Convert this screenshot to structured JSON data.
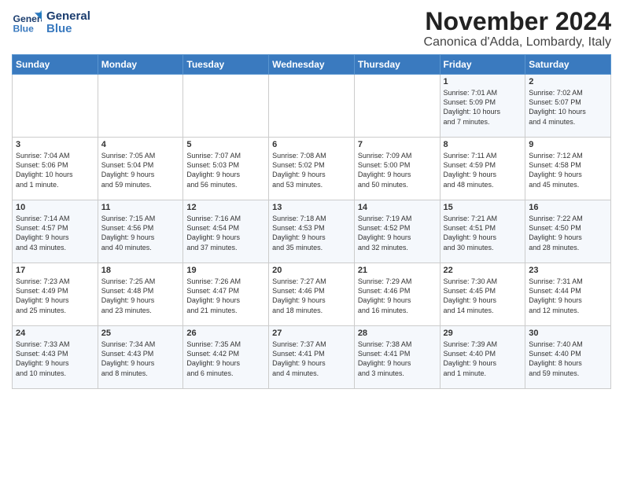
{
  "logo": {
    "line1": "General",
    "line2": "Blue"
  },
  "title": "November 2024",
  "subtitle": "Canonica d'Adda, Lombardy, Italy",
  "headers": [
    "Sunday",
    "Monday",
    "Tuesday",
    "Wednesday",
    "Thursday",
    "Friday",
    "Saturday"
  ],
  "weeks": [
    [
      {
        "num": "",
        "info": ""
      },
      {
        "num": "",
        "info": ""
      },
      {
        "num": "",
        "info": ""
      },
      {
        "num": "",
        "info": ""
      },
      {
        "num": "",
        "info": ""
      },
      {
        "num": "1",
        "info": "Sunrise: 7:01 AM\nSunset: 5:09 PM\nDaylight: 10 hours\nand 7 minutes."
      },
      {
        "num": "2",
        "info": "Sunrise: 7:02 AM\nSunset: 5:07 PM\nDaylight: 10 hours\nand 4 minutes."
      }
    ],
    [
      {
        "num": "3",
        "info": "Sunrise: 7:04 AM\nSunset: 5:06 PM\nDaylight: 10 hours\nand 1 minute."
      },
      {
        "num": "4",
        "info": "Sunrise: 7:05 AM\nSunset: 5:04 PM\nDaylight: 9 hours\nand 59 minutes."
      },
      {
        "num": "5",
        "info": "Sunrise: 7:07 AM\nSunset: 5:03 PM\nDaylight: 9 hours\nand 56 minutes."
      },
      {
        "num": "6",
        "info": "Sunrise: 7:08 AM\nSunset: 5:02 PM\nDaylight: 9 hours\nand 53 minutes."
      },
      {
        "num": "7",
        "info": "Sunrise: 7:09 AM\nSunset: 5:00 PM\nDaylight: 9 hours\nand 50 minutes."
      },
      {
        "num": "8",
        "info": "Sunrise: 7:11 AM\nSunset: 4:59 PM\nDaylight: 9 hours\nand 48 minutes."
      },
      {
        "num": "9",
        "info": "Sunrise: 7:12 AM\nSunset: 4:58 PM\nDaylight: 9 hours\nand 45 minutes."
      }
    ],
    [
      {
        "num": "10",
        "info": "Sunrise: 7:14 AM\nSunset: 4:57 PM\nDaylight: 9 hours\nand 43 minutes."
      },
      {
        "num": "11",
        "info": "Sunrise: 7:15 AM\nSunset: 4:56 PM\nDaylight: 9 hours\nand 40 minutes."
      },
      {
        "num": "12",
        "info": "Sunrise: 7:16 AM\nSunset: 4:54 PM\nDaylight: 9 hours\nand 37 minutes."
      },
      {
        "num": "13",
        "info": "Sunrise: 7:18 AM\nSunset: 4:53 PM\nDaylight: 9 hours\nand 35 minutes."
      },
      {
        "num": "14",
        "info": "Sunrise: 7:19 AM\nSunset: 4:52 PM\nDaylight: 9 hours\nand 32 minutes."
      },
      {
        "num": "15",
        "info": "Sunrise: 7:21 AM\nSunset: 4:51 PM\nDaylight: 9 hours\nand 30 minutes."
      },
      {
        "num": "16",
        "info": "Sunrise: 7:22 AM\nSunset: 4:50 PM\nDaylight: 9 hours\nand 28 minutes."
      }
    ],
    [
      {
        "num": "17",
        "info": "Sunrise: 7:23 AM\nSunset: 4:49 PM\nDaylight: 9 hours\nand 25 minutes."
      },
      {
        "num": "18",
        "info": "Sunrise: 7:25 AM\nSunset: 4:48 PM\nDaylight: 9 hours\nand 23 minutes."
      },
      {
        "num": "19",
        "info": "Sunrise: 7:26 AM\nSunset: 4:47 PM\nDaylight: 9 hours\nand 21 minutes."
      },
      {
        "num": "20",
        "info": "Sunrise: 7:27 AM\nSunset: 4:46 PM\nDaylight: 9 hours\nand 18 minutes."
      },
      {
        "num": "21",
        "info": "Sunrise: 7:29 AM\nSunset: 4:46 PM\nDaylight: 9 hours\nand 16 minutes."
      },
      {
        "num": "22",
        "info": "Sunrise: 7:30 AM\nSunset: 4:45 PM\nDaylight: 9 hours\nand 14 minutes."
      },
      {
        "num": "23",
        "info": "Sunrise: 7:31 AM\nSunset: 4:44 PM\nDaylight: 9 hours\nand 12 minutes."
      }
    ],
    [
      {
        "num": "24",
        "info": "Sunrise: 7:33 AM\nSunset: 4:43 PM\nDaylight: 9 hours\nand 10 minutes."
      },
      {
        "num": "25",
        "info": "Sunrise: 7:34 AM\nSunset: 4:43 PM\nDaylight: 9 hours\nand 8 minutes."
      },
      {
        "num": "26",
        "info": "Sunrise: 7:35 AM\nSunset: 4:42 PM\nDaylight: 9 hours\nand 6 minutes."
      },
      {
        "num": "27",
        "info": "Sunrise: 7:37 AM\nSunset: 4:41 PM\nDaylight: 9 hours\nand 4 minutes."
      },
      {
        "num": "28",
        "info": "Sunrise: 7:38 AM\nSunset: 4:41 PM\nDaylight: 9 hours\nand 3 minutes."
      },
      {
        "num": "29",
        "info": "Sunrise: 7:39 AM\nSunset: 4:40 PM\nDaylight: 9 hours\nand 1 minute."
      },
      {
        "num": "30",
        "info": "Sunrise: 7:40 AM\nSunset: 4:40 PM\nDaylight: 8 hours\nand 59 minutes."
      }
    ]
  ]
}
